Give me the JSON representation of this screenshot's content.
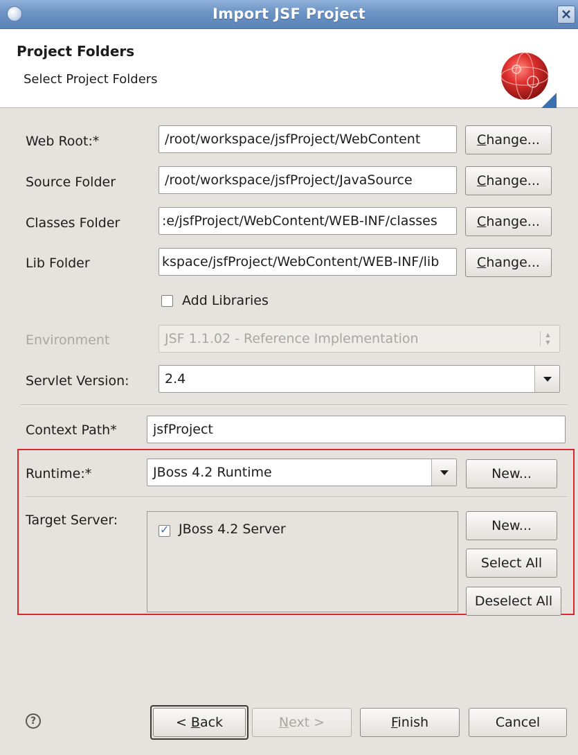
{
  "window": {
    "title": "Import JSF Project"
  },
  "header": {
    "title": "Project Folders",
    "description": "Select Project Folders"
  },
  "fields": {
    "web_root": {
      "label": "Web Root:*",
      "value": "/root/workspace/jsfProject/WebContent",
      "button_mnemonic": "C",
      "button_rest": "hange..."
    },
    "source_folder": {
      "label": "Source Folder",
      "value": "/root/workspace/jsfProject/JavaSource",
      "button_mnemonic": "C",
      "button_rest": "hange..."
    },
    "classes_folder": {
      "label": "Classes Folder",
      "value": ":e/jsfProject/WebContent/WEB-INF/classes",
      "button_mnemonic": "C",
      "button_rest": "hange..."
    },
    "lib_folder": {
      "label": "Lib Folder",
      "value": "kspace/jsfProject/WebContent/WEB-INF/lib",
      "button_mnemonic": "C",
      "button_rest": "hange..."
    }
  },
  "add_libraries": {
    "label": "Add Libraries",
    "checked": false
  },
  "environment": {
    "label": "Environment",
    "value": "JSF 1.1.02 - Reference Implementation",
    "disabled": true
  },
  "servlet_version": {
    "label": "Servlet Version:",
    "value": "2.4"
  },
  "context_path": {
    "label": "Context Path*",
    "value": "jsfProject"
  },
  "runtime": {
    "label": "Runtime:*",
    "value": "JBoss 4.2 Runtime",
    "new_button": "New..."
  },
  "target_server": {
    "label": "Target Server:",
    "items": [
      {
        "label": "JBoss 4.2 Server",
        "checked": true
      }
    ],
    "new_button": "New...",
    "select_all_button": "Select All",
    "deselect_all_button": "Deselect All"
  },
  "footer": {
    "help_glyph": "?",
    "back": {
      "prefix": "< ",
      "mnemonic": "B",
      "rest": "ack"
    },
    "next": {
      "mnemonic": "N",
      "rest": "ext >"
    },
    "finish": {
      "mnemonic": "F",
      "rest": "inish"
    },
    "cancel": "Cancel"
  },
  "colors": {
    "highlight_box": "#d9262c",
    "titlebar": "#6c93c4"
  }
}
